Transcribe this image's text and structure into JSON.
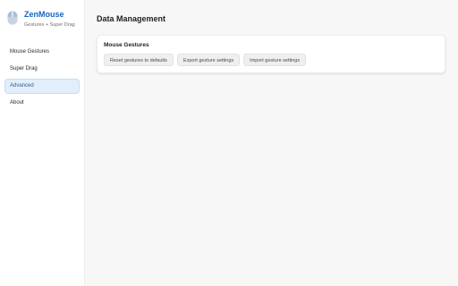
{
  "app": {
    "name": "ZenMouse",
    "tagline": "Gestures + Super Drag",
    "accent_color": "#1565c0"
  },
  "sidebar": {
    "items": [
      {
        "label": "Mouse Gestures",
        "active": false
      },
      {
        "label": "Super Drag",
        "active": false
      },
      {
        "label": "Advanced",
        "active": true
      },
      {
        "label": "About",
        "active": false
      }
    ]
  },
  "main": {
    "title": "Data Management",
    "section": {
      "title": "Mouse Gestures",
      "buttons": {
        "reset": "Reset gestures to defaults",
        "export": "Export gesture settings",
        "import": "Import gesture settings"
      }
    }
  }
}
